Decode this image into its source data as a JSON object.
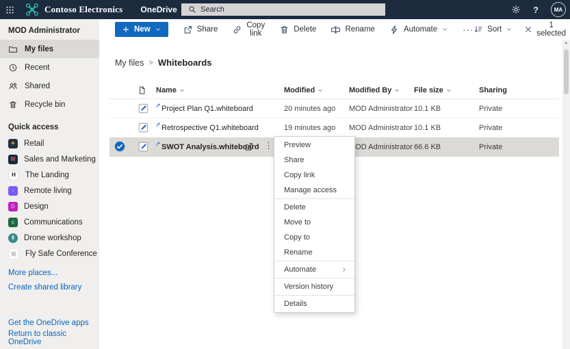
{
  "theme": {
    "header_bg": "#1c2b3e",
    "brand_teal": "#2fb7ae",
    "primary_blue": "#1168bf",
    "link_blue": "#0a64bb",
    "sidebar_bg": "#f0efed",
    "selected_bg": "#dcdad7",
    "check_circle": "#1168bf"
  },
  "header": {
    "brand": "Contoso Electronics",
    "product": "OneDrive",
    "search_placeholder": "Search",
    "avatar_initials": "MA"
  },
  "toolbar": {
    "new": {
      "label": "New"
    },
    "buttons": [
      {
        "label": "Share",
        "icon": "share"
      },
      {
        "label": "Copy link",
        "icon": "link"
      },
      {
        "label": "Delete",
        "icon": "trash"
      },
      {
        "label": "Rename",
        "icon": "rename"
      },
      {
        "label": "Automate",
        "icon": "automate",
        "chevron": true
      }
    ],
    "more_label": "···",
    "sort_label": "Sort",
    "selection_label": "1 selected"
  },
  "sidebar": {
    "account": "MOD Administrator",
    "nav": [
      {
        "label": "My files",
        "icon": "folder",
        "selected": true
      },
      {
        "label": "Recent",
        "icon": "history",
        "selected": false
      },
      {
        "label": "Shared",
        "icon": "people",
        "selected": false
      },
      {
        "label": "Recycle bin",
        "icon": "bin",
        "selected": false
      }
    ],
    "quick_access_title": "Quick access",
    "quick_access": [
      {
        "label": "Retail",
        "bg": "#22313f",
        "fg": "#e8a33d",
        "glyph": "✦",
        "shape": "square"
      },
      {
        "label": "Sales and Marketing",
        "bg": "#15293c",
        "fg": "#d85c5c",
        "glyph": "M",
        "shape": "square"
      },
      {
        "label": "The Landing",
        "bg": "#ffffff",
        "fg": "#1b1a19",
        "glyph": "H",
        "shape": "circle",
        "border": "#dddbd9"
      },
      {
        "label": "Remote living",
        "bg": "#7a5af5",
        "fg": "#b3a3fa",
        "glyph": "▪",
        "shape": "square"
      },
      {
        "label": "Design",
        "bg": "#c01ec0",
        "fg": "#e489e4",
        "glyph": "D",
        "shape": "square"
      },
      {
        "label": "Communications",
        "bg": "#1d6840",
        "fg": "#8fd4ac",
        "glyph": "c",
        "shape": "square"
      },
      {
        "label": "Drone workshop",
        "bg": "#37898c",
        "fg": "#ffffff",
        "glyph": "‖",
        "shape": "circle"
      },
      {
        "label": "Fly Safe Conference",
        "bg": "#fbfafa",
        "fg": "#c9c7c5",
        "glyph": "▦",
        "shape": "square",
        "border": "#e8e6e4"
      }
    ],
    "links": [
      "More places...",
      "Create shared library"
    ],
    "footer_links": [
      "Get the OneDrive apps",
      "Return to classic OneDrive"
    ]
  },
  "breadcrumb": {
    "parent": "My files",
    "separator": ">",
    "current": "Whiteboards"
  },
  "table": {
    "columns": [
      {
        "label": "Name",
        "caret": true
      },
      {
        "label": "Modified",
        "caret": true
      },
      {
        "label": "Modified By",
        "caret": true
      },
      {
        "label": "File size",
        "caret": true
      },
      {
        "label": "Sharing",
        "caret": false
      }
    ],
    "rows": [
      {
        "name": "Project Plan Q1.whiteboard",
        "modified": "20 minutes ago",
        "modified_by": "MOD Administrator",
        "size": "10.1 KB",
        "sharing": "Private",
        "selected": false
      },
      {
        "name": "Retrospective Q1.whiteboard",
        "modified": "19 minutes ago",
        "modified_by": "MOD Administrator",
        "size": "10.1 KB",
        "sharing": "Private",
        "selected": false
      },
      {
        "name": "SWOT Analysis.whiteboard",
        "modified": "",
        "modified_by": "MOD Administrator",
        "size": "66.6 KB",
        "sharing": "Private",
        "selected": true
      }
    ]
  },
  "context_menu": {
    "items": [
      {
        "label": "Preview"
      },
      {
        "label": "Share"
      },
      {
        "label": "Copy link"
      },
      {
        "label": "Manage access",
        "divider_after": true
      },
      {
        "label": "Delete"
      },
      {
        "label": "Move to"
      },
      {
        "label": "Copy to"
      },
      {
        "label": "Rename",
        "divider_after": true
      },
      {
        "label": "Automate",
        "submenu": true,
        "divider_after": true
      },
      {
        "label": "Version history",
        "divider_after": true
      },
      {
        "label": "Details"
      }
    ]
  }
}
